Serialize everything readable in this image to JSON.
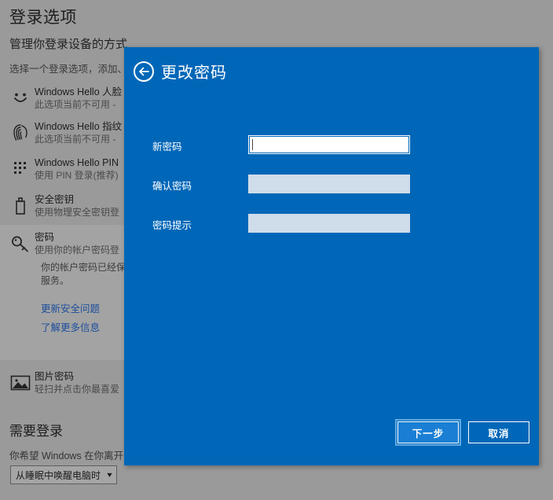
{
  "page": {
    "title": "登录选项",
    "subtitle": "管理你登录设备的方式",
    "description": "选择一个登录选项，添加、",
    "options": [
      {
        "icon": "face-icon",
        "title": "Windows Hello 人脸",
        "subtitle": "此选项当前不可用 -"
      },
      {
        "icon": "fingerprint-icon",
        "title": "Windows Hello 指纹",
        "subtitle": "此选项当前不可用 -"
      },
      {
        "icon": "pin-keypad-icon",
        "title": "Windows Hello PIN",
        "subtitle": "使用 PIN 登录(推荐)"
      },
      {
        "icon": "security-key-icon",
        "title": "安全密钥",
        "subtitle": "使用物理安全密钥登"
      },
      {
        "icon": "key-icon",
        "title": "密码",
        "subtitle": "使用你的帐户密码登"
      },
      {
        "icon": "picture-icon",
        "title": "图片密码",
        "subtitle": "轻扫并点击你最喜爱"
      }
    ],
    "password_note_line1": "你的帐户密码已经保",
    "password_note_line2": "服务。",
    "links": [
      {
        "label": "更新安全问题"
      },
      {
        "label": "了解更多信息"
      }
    ],
    "signin_required": {
      "title": "需要登录",
      "description": "你希望 Windows 在你离开E",
      "selected_option": "从睡眠中唤醒电脑时",
      "chevron": "chevron-down-icon"
    }
  },
  "dialog": {
    "back_icon": "back-arrow-icon",
    "title": "更改密码",
    "fields": [
      {
        "label": "新密码",
        "value": "",
        "focused": true
      },
      {
        "label": "确认密码",
        "value": "",
        "focused": false
      },
      {
        "label": "密码提示",
        "value": "",
        "focused": false
      }
    ],
    "next_label": "下一步",
    "cancel_label": "取消"
  },
  "colors": {
    "dialog_background": "#0067b8",
    "page_background": "#9a9a9a",
    "highlight_row": "#a3a3a3",
    "input_idle": "#cfdcea",
    "input_focus": "#ffffff",
    "link": "#1c4f9c",
    "primary_button": "#1a7fd4"
  }
}
